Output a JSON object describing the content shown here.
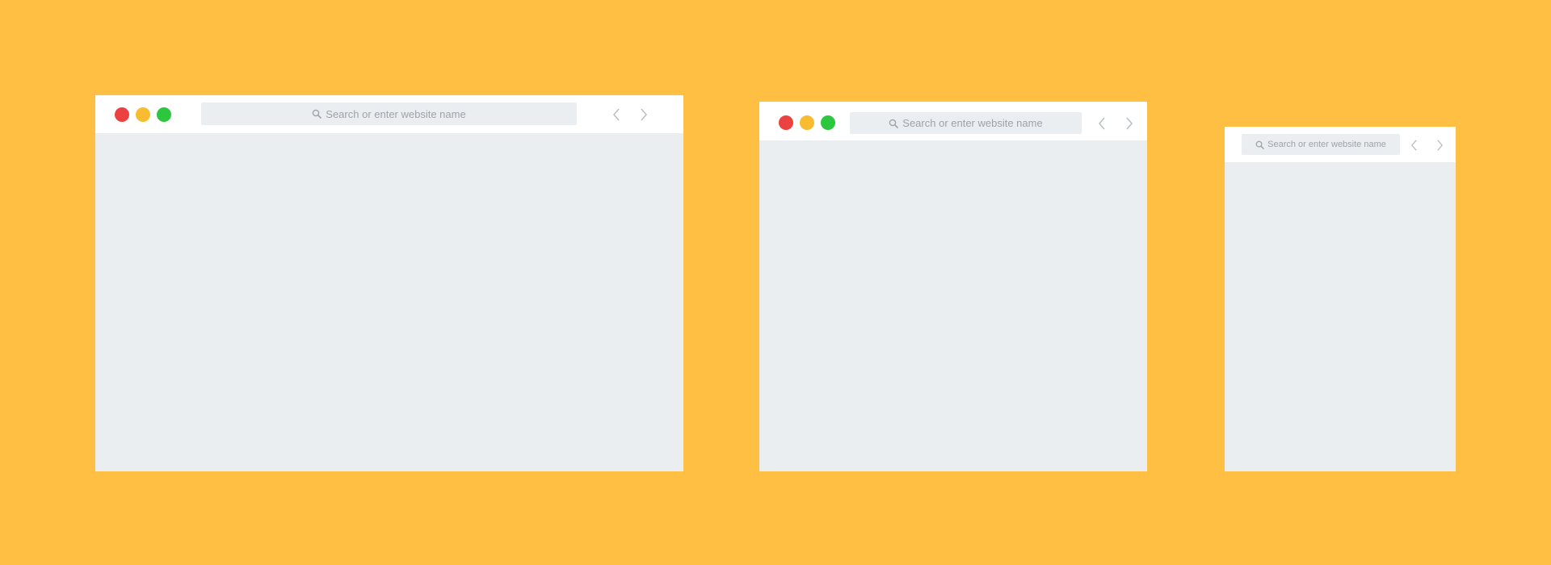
{
  "colors": {
    "background": "#FFBF43",
    "window_chrome": "#FFFFFF",
    "content_area": "#EBEEF0",
    "address_bar": "#EBEEF0",
    "address_text": "#9DA3A9",
    "nav_arrow": "#B8BDC2",
    "close_dot": "#EB4241",
    "minimize_dot": "#F9BB30",
    "maximize_dot": "#2DC63F"
  },
  "icons": {
    "search": "magnifier-icon",
    "back": "chevron-left-icon",
    "forward": "chevron-right-icon"
  },
  "windows": [
    {
      "name": "large",
      "traffic_lights": [
        "close",
        "minimize",
        "maximize"
      ],
      "address_bar": {
        "placeholder": "Search or enter website name"
      }
    },
    {
      "name": "medium",
      "traffic_lights": [
        "close",
        "minimize",
        "maximize"
      ],
      "address_bar": {
        "placeholder": "Search or enter website name"
      }
    },
    {
      "name": "small",
      "traffic_lights": [],
      "address_bar": {
        "placeholder": "Search or enter website name"
      }
    }
  ]
}
